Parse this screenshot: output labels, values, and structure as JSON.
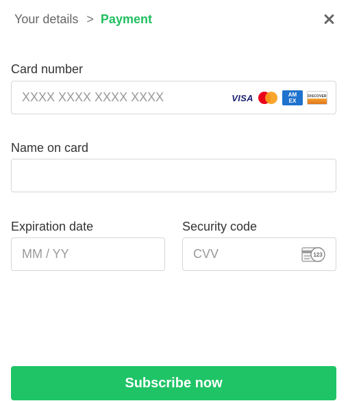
{
  "breadcrumb": {
    "previous": "Your details",
    "separator": ">",
    "current": "Payment"
  },
  "close": {
    "icon": "close-icon"
  },
  "card_number": {
    "label": "Card number",
    "placeholder": "XXXX XXXX XXXX XXXX",
    "value": "",
    "logos": {
      "visa": "VISA",
      "mastercard": "mastercard-icon",
      "amex_line1": "AM",
      "amex_line2": "EX",
      "discover": "DISCOVER"
    }
  },
  "name_on_card": {
    "label": "Name on card",
    "placeholder": "",
    "value": ""
  },
  "expiration": {
    "label": "Expiration date",
    "placeholder": "MM / YY",
    "value": ""
  },
  "security_code": {
    "label": "Security code",
    "placeholder": "CVV",
    "value": "",
    "icon": "cvv-card-icon",
    "icon_text": "123"
  },
  "submit": {
    "label": "Subscribe now"
  },
  "colors": {
    "accent": "#1fbf5f",
    "button": "#1fc466",
    "border": "#d6d6d6",
    "placeholder": "#999999"
  }
}
